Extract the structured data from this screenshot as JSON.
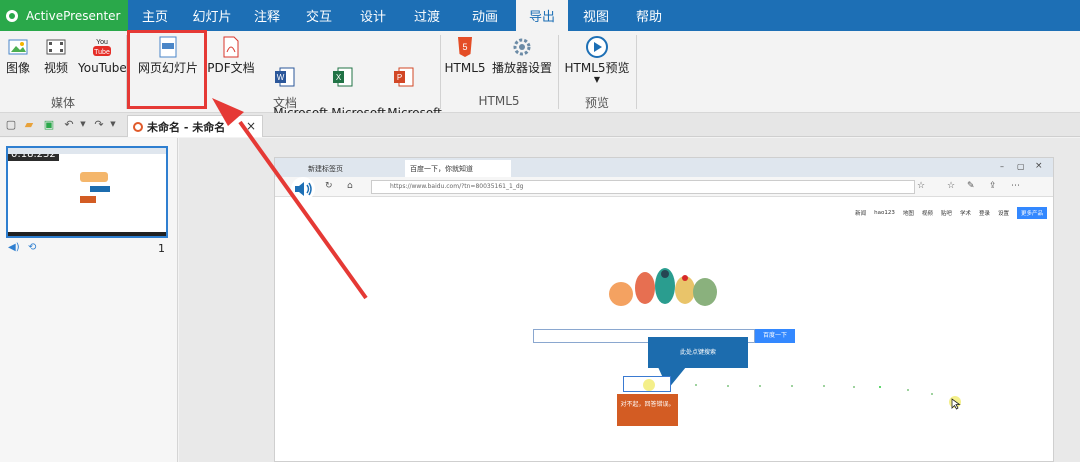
{
  "app": {
    "name": "ActivePresenter"
  },
  "menu": {
    "tabs": [
      {
        "label": "主页"
      },
      {
        "label": "幻灯片"
      },
      {
        "label": "注释"
      },
      {
        "label": "交互"
      },
      {
        "label": "设计"
      },
      {
        "label": "过渡"
      },
      {
        "label": "动画"
      },
      {
        "label": "导出"
      },
      {
        "label": "视图"
      },
      {
        "label": "帮助"
      }
    ],
    "active": "导出"
  },
  "ribbon": {
    "buttons": [
      {
        "label": "图像"
      },
      {
        "label": "视频"
      },
      {
        "label": "YouTube"
      },
      {
        "label": "网页幻灯片"
      },
      {
        "label": "PDF文档"
      },
      {
        "label": "Microsoft\nWord"
      },
      {
        "label": "Microsoft\nExcel"
      },
      {
        "label": "Microsoft\nPowerPoint"
      },
      {
        "label": "HTML5"
      },
      {
        "label": "播放器设置"
      },
      {
        "label": "HTML5预览"
      }
    ],
    "groups": [
      {
        "label": "媒体"
      },
      {
        "label": "文档"
      },
      {
        "label": "HTML5"
      },
      {
        "label": "预览"
      }
    ],
    "highlight_color": "#e53935"
  },
  "document": {
    "tab_title": "未命名 - 未命名",
    "close": "×"
  },
  "slide_panel": {
    "time": "0:18.232",
    "number": "1"
  },
  "browser": {
    "tabs": [
      {
        "label": "新建标签页"
      },
      {
        "label": "百度一下，你就知道"
      }
    ],
    "url": "https://www.baidu.com/?tn=80035161_1_dg",
    "top_links": [
      "新闻",
      "hao123",
      "地图",
      "视频",
      "贴吧",
      "学术",
      "登录",
      "设置"
    ],
    "more": "更多产品",
    "search_button": "百度一下"
  },
  "annotations": {
    "callout": "此处点键搜索",
    "orange_note": "对不起，回答错误。"
  },
  "colors": {
    "menubar": "#1d6fb5",
    "brand": "#2aa84a",
    "callout": "#1c6cae",
    "note": "#d35c23"
  }
}
